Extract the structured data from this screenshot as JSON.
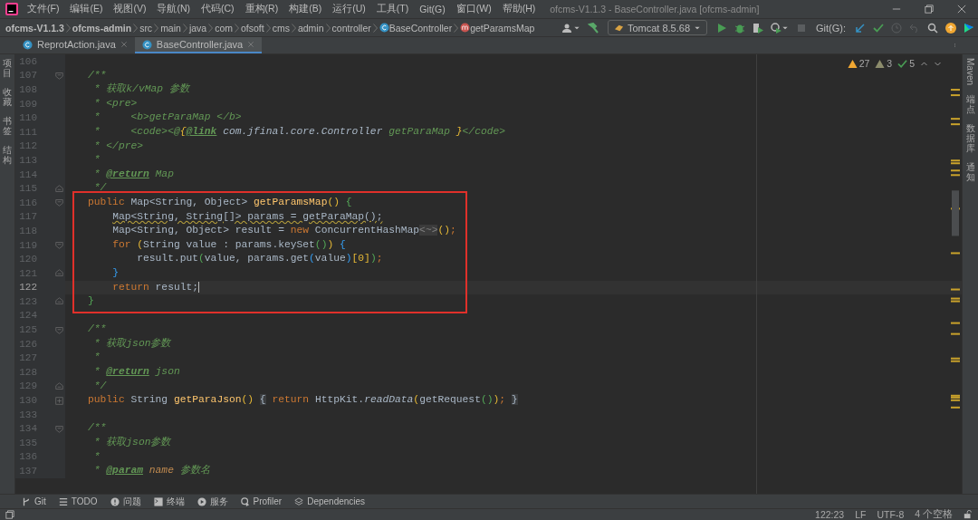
{
  "window": {
    "title": "ofcms-V1.1.3 - BaseController.java [ofcms-admin]"
  },
  "menu": [
    "文件(F)",
    "编辑(E)",
    "视图(V)",
    "导航(N)",
    "代码(C)",
    "重构(R)",
    "构建(B)",
    "运行(U)",
    "工具(T)",
    "Git(G)",
    "窗口(W)",
    "帮助(H)"
  ],
  "breadcrumbs": [
    {
      "label": "ofcms-V1.1.3",
      "kind": "bold"
    },
    {
      "label": "ofcms-admin",
      "kind": "bold"
    },
    {
      "label": "src",
      "kind": "plain"
    },
    {
      "label": "main",
      "kind": "plain"
    },
    {
      "label": "java",
      "kind": "plain"
    },
    {
      "label": "com",
      "kind": "plain"
    },
    {
      "label": "ofsoft",
      "kind": "plain"
    },
    {
      "label": "cms",
      "kind": "plain"
    },
    {
      "label": "admin",
      "kind": "plain"
    },
    {
      "label": "controller",
      "kind": "plain"
    },
    {
      "label": "BaseController",
      "kind": "class"
    },
    {
      "label": "getParamsMap",
      "kind": "method"
    }
  ],
  "run_config": "Tomcat 8.5.68",
  "vcs_label": "Git(G):",
  "tabs": [
    {
      "label": "ReprotAction.java",
      "selected": false
    },
    {
      "label": "BaseController.java",
      "selected": true
    }
  ],
  "left_tools": [
    "项目",
    "收藏",
    "书签",
    "结构"
  ],
  "right_tools": [
    "Maven",
    "端点",
    "数据库",
    "通知"
  ],
  "inspections": {
    "warnings": "27",
    "weak_warnings": "3",
    "typos": "5"
  },
  "code": {
    "blocks": [
      {
        "lines": [
          {
            "number": "106"
          },
          {
            "number": "107",
            "fold_start": true,
            "tokens": [
              {
                "text": "/**",
                "kind": "comment"
              }
            ]
          },
          {
            "number": "108",
            "tokens": [
              {
                "text": " * 获取k/vMap 参数",
                "kind": "comment"
              }
            ]
          },
          {
            "number": "109",
            "tokens": [
              {
                "text": " * <pre>",
                "kind": "comment"
              }
            ]
          },
          {
            "number": "110",
            "tokens": [
              {
                "text": " *     <b>getParaMap </b>",
                "kind": "comment"
              }
            ]
          },
          {
            "number": "111",
            "tokens": [
              {
                "text": " *     <code><@",
                "kind": "comment"
              },
              {
                "text": "{",
                "kind": "doc-brace"
              },
              {
                "text": "@link",
                "kind": "doc-tag"
              },
              {
                "text": " com.jfinal.core.Controller ",
                "kind": "doc-ref"
              },
              {
                "text": "getParaMap",
                "kind": "comment"
              },
              {
                "text": " }",
                "kind": "doc-brace"
              },
              {
                "text": "</code>",
                "kind": "comment"
              }
            ]
          },
          {
            "number": "112",
            "tokens": [
              {
                "text": " * </pre>",
                "kind": "comment"
              }
            ]
          },
          {
            "number": "113",
            "tokens": [
              {
                "text": " *",
                "kind": "comment"
              }
            ]
          },
          {
            "number": "114",
            "tokens": [
              {
                "text": " * ",
                "kind": "comment"
              },
              {
                "text": "@return",
                "kind": "doc-tag"
              },
              {
                "text": " Map",
                "kind": "comment"
              }
            ]
          },
          {
            "number": "115",
            "fold_end": true,
            "tokens": [
              {
                "text": " */",
                "kind": "comment"
              }
            ]
          }
        ]
      },
      {
        "boxed": true,
        "lines": [
          {
            "number": "116",
            "fold_start": true,
            "tokens": [
              {
                "text": "public",
                "kind": "keyword"
              },
              {
                "text": " Map<String, Object> ",
                "kind": "plain"
              },
              {
                "text": "getParamsMap",
                "kind": "method"
              },
              {
                "text": "() ",
                "kind": "paren-yellow"
              },
              {
                "text": "{",
                "kind": "paren-green"
              }
            ]
          },
          {
            "number": "117",
            "tokens": [
              {
                "text": "    Map<String, String[]> params = getParaMap();",
                "kind": "warning"
              }
            ]
          },
          {
            "number": "118",
            "tokens": [
              {
                "text": "    Map<String, Object> result = ",
                "kind": "plain"
              },
              {
                "text": "new",
                "kind": "keyword"
              },
              {
                "text": " ConcurrentHashMap",
                "kind": "plain"
              },
              {
                "text": "<~>",
                "kind": "hint"
              },
              {
                "text": "()",
                "kind": "paren-yellow"
              },
              {
                "text": ";",
                "kind": "keyword"
              }
            ]
          },
          {
            "number": "119",
            "fold_start": true,
            "tokens": [
              {
                "text": "    for ",
                "kind": "keyword"
              },
              {
                "text": "(",
                "kind": "paren-yellow"
              },
              {
                "text": "String value : params.keySet",
                "kind": "plain"
              },
              {
                "text": "()",
                "kind": "paren-green"
              },
              {
                "text": ") ",
                "kind": "paren-yellow"
              },
              {
                "text": "{",
                "kind": "paren-blue"
              }
            ]
          },
          {
            "number": "120",
            "tokens": [
              {
                "text": "        result.put",
                "kind": "plain"
              },
              {
                "text": "(",
                "kind": "paren-green"
              },
              {
                "text": "value, params.get",
                "kind": "plain"
              },
              {
                "text": "(",
                "kind": "paren-blue"
              },
              {
                "text": "value",
                "kind": "plain"
              },
              {
                "text": ")",
                "kind": "paren-blue"
              },
              {
                "text": "[0]",
                "kind": "paren-yellow"
              },
              {
                "text": ")",
                "kind": "paren-green"
              },
              {
                "text": ";",
                "kind": "keyword"
              }
            ]
          },
          {
            "number": "121",
            "fold_end": true,
            "tokens": [
              {
                "text": "    }",
                "kind": "paren-blue"
              }
            ]
          },
          {
            "number": "122",
            "current": true,
            "tokens": [
              {
                "text": "    return",
                "kind": "keyword"
              },
              {
                "text": " result;",
                "kind": "plain"
              }
            ]
          },
          {
            "number": "123",
            "fold_end": true,
            "tokens": [
              {
                "text": "}",
                "kind": "paren-green"
              }
            ]
          }
        ]
      },
      {
        "lines": [
          {
            "number": "124"
          },
          {
            "number": "125",
            "fold_start": true,
            "tokens": [
              {
                "text": "/**",
                "kind": "comment"
              }
            ]
          },
          {
            "number": "126",
            "tokens": [
              {
                "text": " * 获取json参数",
                "kind": "comment"
              }
            ]
          },
          {
            "number": "127",
            "tokens": [
              {
                "text": " *",
                "kind": "comment"
              }
            ]
          },
          {
            "number": "128",
            "tokens": [
              {
                "text": " * ",
                "kind": "comment"
              },
              {
                "text": "@return",
                "kind": "doc-tag"
              },
              {
                "text": " json",
                "kind": "comment"
              }
            ]
          },
          {
            "number": "129",
            "fold_end": true,
            "tokens": [
              {
                "text": " */",
                "kind": "comment"
              }
            ]
          },
          {
            "number": "130",
            "collapsed": true,
            "tokens": [
              {
                "text": "public",
                "kind": "keyword"
              },
              {
                "text": " String ",
                "kind": "plain"
              },
              {
                "text": "getParaJson",
                "kind": "method"
              },
              {
                "text": "() ",
                "kind": "paren-yellow"
              },
              {
                "text": "{",
                "kind": "folded"
              },
              {
                "text": " return",
                "kind": "keyword"
              },
              {
                "text": " HttpKit.",
                "kind": "plain"
              },
              {
                "text": "readData",
                "kind": "static"
              },
              {
                "text": "(",
                "kind": "paren-yellow"
              },
              {
                "text": "getRequest",
                "kind": "plain"
              },
              {
                "text": "()",
                "kind": "paren-green"
              },
              {
                "text": ")",
                "kind": "paren-yellow"
              },
              {
                "text": "; ",
                "kind": "keyword"
              },
              {
                "text": "}",
                "kind": "folded"
              }
            ]
          },
          {
            "number": "133"
          },
          {
            "number": "134",
            "fold_start": true,
            "tokens": [
              {
                "text": "/**",
                "kind": "comment"
              }
            ]
          },
          {
            "number": "135",
            "tokens": [
              {
                "text": " * 获取json参数",
                "kind": "comment"
              }
            ]
          },
          {
            "number": "136",
            "tokens": [
              {
                "text": " *",
                "kind": "comment"
              }
            ]
          },
          {
            "number": "137",
            "tokens": [
              {
                "text": " * ",
                "kind": "comment"
              },
              {
                "text": "@param",
                "kind": "doc-tag"
              },
              {
                "text": " name",
                "kind": "param"
              },
              {
                "text": " 参数名",
                "kind": "comment"
              }
            ]
          }
        ]
      }
    ]
  },
  "bottom_tools": [
    {
      "label": "Git",
      "kind": "git"
    },
    {
      "label": "TODO",
      "kind": "list"
    },
    {
      "label": "问题",
      "kind": "alert"
    },
    {
      "label": "终端",
      "kind": "terminal"
    },
    {
      "label": "服务",
      "kind": "play"
    },
    {
      "label": "Profiler",
      "kind": "profiler"
    },
    {
      "label": "Dependencies",
      "kind": "layers"
    }
  ],
  "status_bar": {
    "position": "122:23",
    "line_ending": "LF",
    "encoding": "UTF-8",
    "indent": "4 个空格"
  }
}
